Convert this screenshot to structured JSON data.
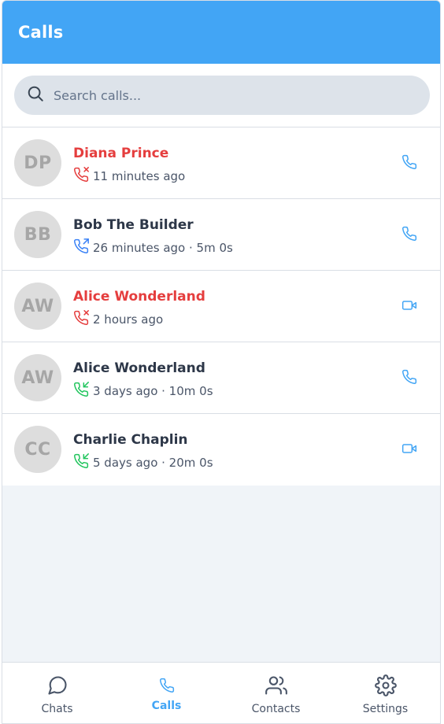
{
  "header": {
    "title": "Calls"
  },
  "search": {
    "placeholder": "Search calls..."
  },
  "colors": {
    "accent": "#42a5f5",
    "missed": "#e53e3e",
    "outgoing": "#3b82f6",
    "incoming": "#22c55e"
  },
  "calls": [
    {
      "initials": "DP",
      "name": "Diana Prince",
      "detail": "11 minutes ago",
      "status": "missed",
      "direction_icon": "phone-missed-icon",
      "action_icon": "phone-icon"
    },
    {
      "initials": "BB",
      "name": "Bob The Builder",
      "detail": "26 minutes ago · 5m 0s",
      "status": "outgoing",
      "direction_icon": "phone-outgoing-icon",
      "action_icon": "phone-icon"
    },
    {
      "initials": "AW",
      "name": "Alice Wonderland",
      "detail": "2 hours ago",
      "status": "missed",
      "direction_icon": "phone-missed-icon",
      "action_icon": "video-icon"
    },
    {
      "initials": "AW",
      "name": "Alice Wonderland",
      "detail": "3 days ago · 10m 0s",
      "status": "incoming",
      "direction_icon": "phone-incoming-icon",
      "action_icon": "phone-icon"
    },
    {
      "initials": "CC",
      "name": "Charlie Chaplin",
      "detail": "5 days ago · 20m 0s",
      "status": "incoming",
      "direction_icon": "phone-incoming-icon",
      "action_icon": "video-icon"
    }
  ],
  "nav": [
    {
      "label": "Chats",
      "icon": "chat-bubble-icon",
      "active": false
    },
    {
      "label": "Calls",
      "icon": "phone-icon",
      "active": true
    },
    {
      "label": "Contacts",
      "icon": "users-icon",
      "active": false
    },
    {
      "label": "Settings",
      "icon": "gear-icon",
      "active": false
    }
  ]
}
